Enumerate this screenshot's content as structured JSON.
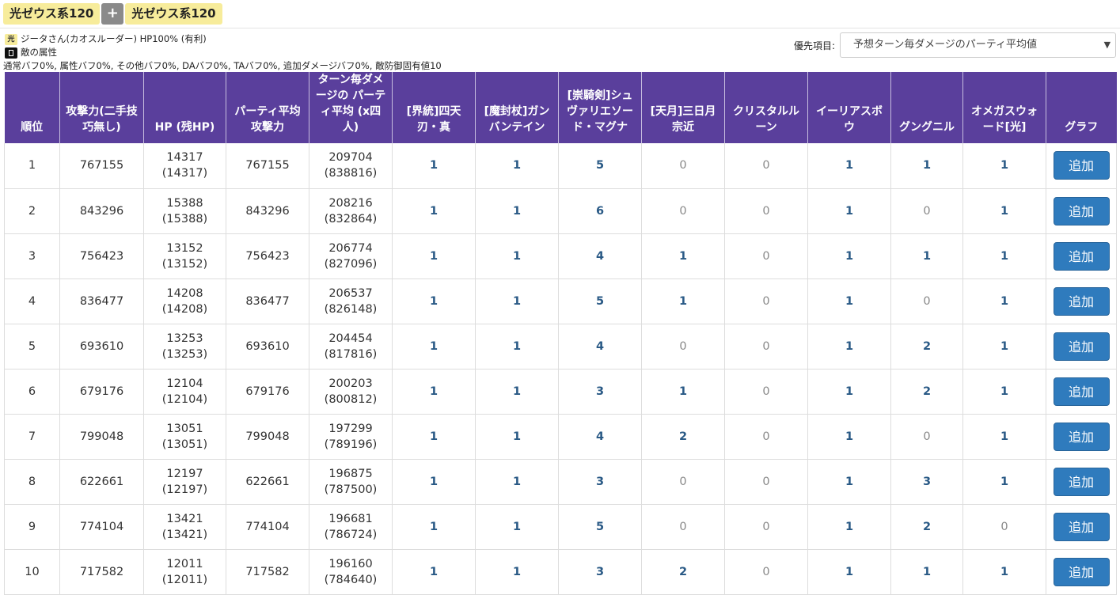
{
  "header": {
    "chip_left": "光ゼウス系120",
    "plus_label": "+",
    "chip_right": "光ゼウス系120"
  },
  "info": {
    "element_badge": "光",
    "character_line": "ジータさん(カオスルーダー) HP100% (有利)",
    "enemy_label": "敵の属性",
    "buff_line": "通常バフ0%, 属性バフ0%, その他バフ0%, DAバフ0%, TAバフ0%, 追加ダメージバフ0%, 敵防御固有値10"
  },
  "priority": {
    "label": "優先項目:",
    "selected": "予想ターン毎ダメージのパーティ平均値"
  },
  "table": {
    "headers": [
      "順位",
      "攻撃力(二手技巧無し)",
      "HP (残HP)",
      "パーティ平均攻撃力",
      "ターン毎ダメージの パーティ平均 (x四人)",
      "[界統]四天刃・真",
      "[魔封杖]ガンバンテイン",
      "[崇騎剣]シュヴァリエソード・マグナ",
      "[天月]三日月宗近",
      "クリスタルルーン",
      "イーリアスボウ",
      "グングニル",
      "オメガスウォード[光]",
      "グラフ"
    ],
    "button_label": "追加",
    "rows": [
      {
        "rank": "1",
        "atk": "767155",
        "hp": "14317",
        "hp_rem": "(14317)",
        "party_atk": "767155",
        "dmg": "209704",
        "dmg_x4": "(838816)",
        "w": [
          "1",
          "1",
          "5",
          "0",
          "0",
          "1",
          "1",
          "1"
        ]
      },
      {
        "rank": "2",
        "atk": "843296",
        "hp": "15388",
        "hp_rem": "(15388)",
        "party_atk": "843296",
        "dmg": "208216",
        "dmg_x4": "(832864)",
        "w": [
          "1",
          "1",
          "6",
          "0",
          "0",
          "1",
          "0",
          "1"
        ]
      },
      {
        "rank": "3",
        "atk": "756423",
        "hp": "13152",
        "hp_rem": "(13152)",
        "party_atk": "756423",
        "dmg": "206774",
        "dmg_x4": "(827096)",
        "w": [
          "1",
          "1",
          "4",
          "1",
          "0",
          "1",
          "1",
          "1"
        ]
      },
      {
        "rank": "4",
        "atk": "836477",
        "hp": "14208",
        "hp_rem": "(14208)",
        "party_atk": "836477",
        "dmg": "206537",
        "dmg_x4": "(826148)",
        "w": [
          "1",
          "1",
          "5",
          "1",
          "0",
          "1",
          "0",
          "1"
        ]
      },
      {
        "rank": "5",
        "atk": "693610",
        "hp": "13253",
        "hp_rem": "(13253)",
        "party_atk": "693610",
        "dmg": "204454",
        "dmg_x4": "(817816)",
        "w": [
          "1",
          "1",
          "4",
          "0",
          "0",
          "1",
          "2",
          "1"
        ]
      },
      {
        "rank": "6",
        "atk": "679176",
        "hp": "12104",
        "hp_rem": "(12104)",
        "party_atk": "679176",
        "dmg": "200203",
        "dmg_x4": "(800812)",
        "w": [
          "1",
          "1",
          "3",
          "1",
          "0",
          "1",
          "2",
          "1"
        ]
      },
      {
        "rank": "7",
        "atk": "799048",
        "hp": "13051",
        "hp_rem": "(13051)",
        "party_atk": "799048",
        "dmg": "197299",
        "dmg_x4": "(789196)",
        "w": [
          "1",
          "1",
          "4",
          "2",
          "0",
          "1",
          "0",
          "1"
        ]
      },
      {
        "rank": "8",
        "atk": "622661",
        "hp": "12197",
        "hp_rem": "(12197)",
        "party_atk": "622661",
        "dmg": "196875",
        "dmg_x4": "(787500)",
        "w": [
          "1",
          "1",
          "3",
          "0",
          "0",
          "1",
          "3",
          "1"
        ]
      },
      {
        "rank": "9",
        "atk": "774104",
        "hp": "13421",
        "hp_rem": "(13421)",
        "party_atk": "774104",
        "dmg": "196681",
        "dmg_x4": "(786724)",
        "w": [
          "1",
          "1",
          "5",
          "0",
          "0",
          "1",
          "2",
          "0"
        ]
      },
      {
        "rank": "10",
        "atk": "717582",
        "hp": "12011",
        "hp_rem": "(12011)",
        "party_atk": "717582",
        "dmg": "196160",
        "dmg_x4": "(784640)",
        "w": [
          "1",
          "1",
          "3",
          "2",
          "0",
          "1",
          "1",
          "1"
        ]
      }
    ]
  }
}
